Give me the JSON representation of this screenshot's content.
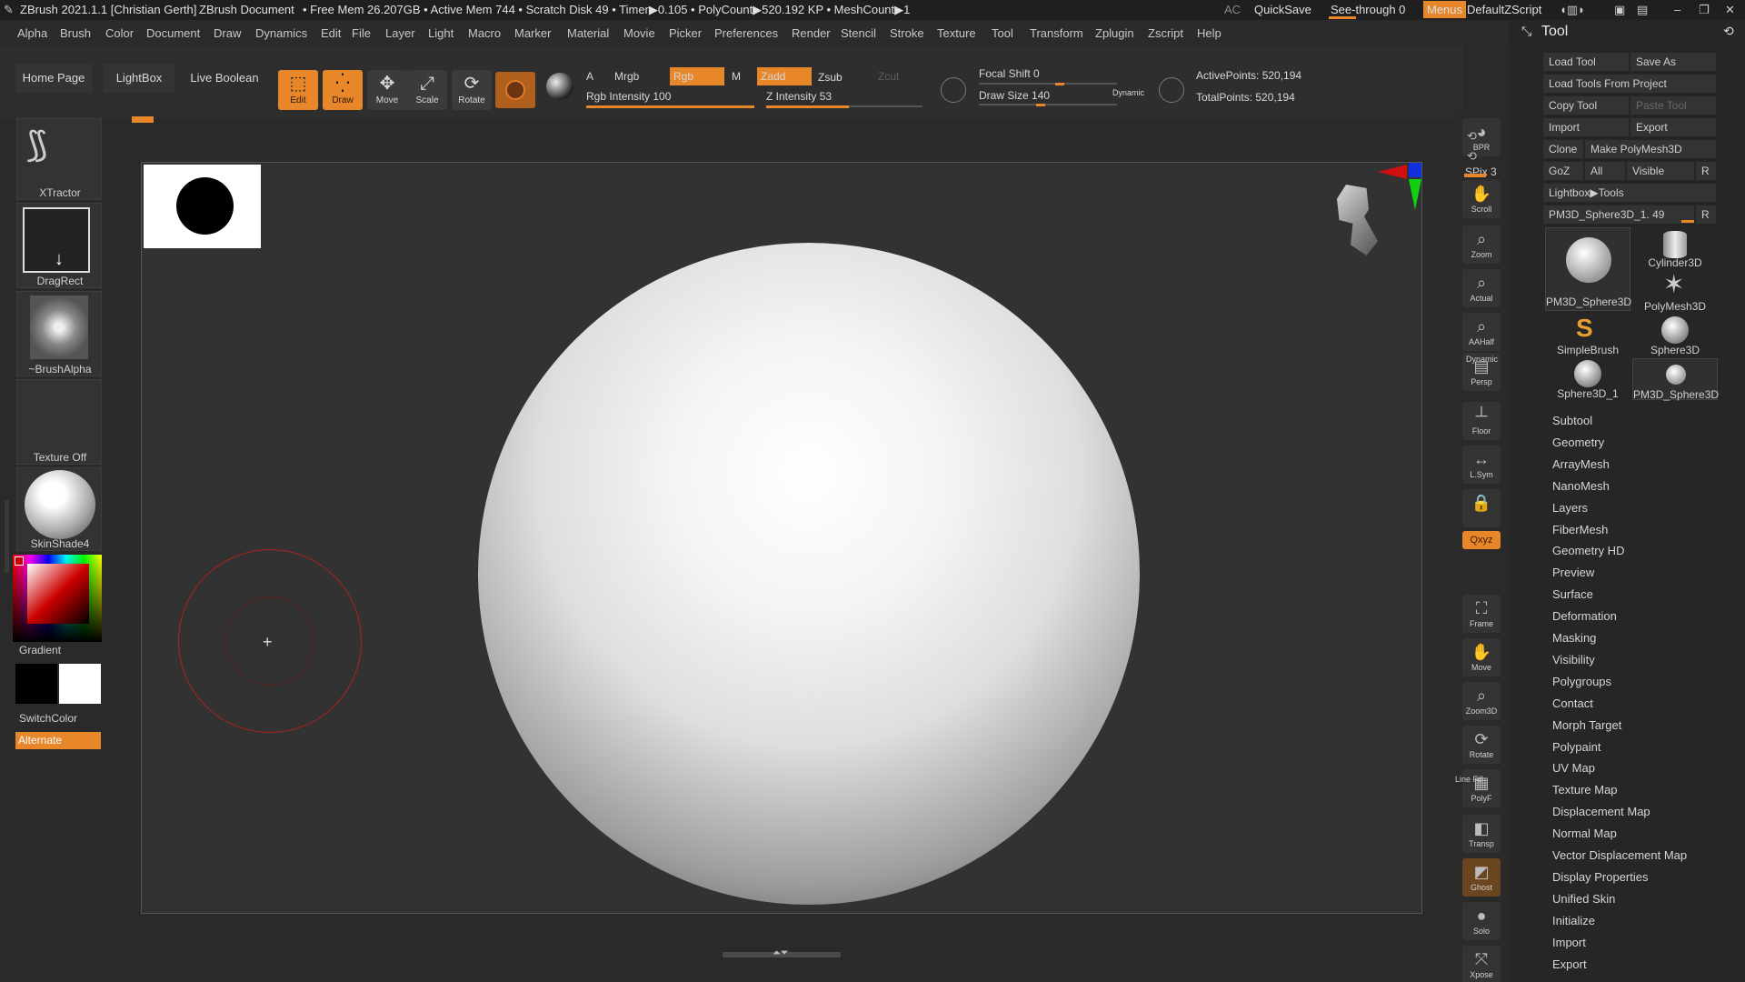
{
  "titlebar": {
    "app": "ZBrush 2021.1.1 [Christian Gerth]",
    "document": "ZBrush Document",
    "stats": "• Free Mem 26.207GB • Active Mem 744 • Scratch Disk 49 • Timer▶0.105 • PolyCount▶520.192 KP • MeshCount▶1",
    "ac": "AC",
    "quicksave": "QuickSave",
    "see_through": "See-through  0",
    "menus": "Menus",
    "script": "DefaultZScript"
  },
  "menubar": [
    "Alpha",
    "Brush",
    "Color",
    "Document",
    "Draw",
    "Dynamics",
    "Edit",
    "File",
    "Layer",
    "Light",
    "Macro",
    "Marker",
    "Material",
    "Movie",
    "Picker",
    "Preferences",
    "Render",
    "Stencil",
    "Stroke",
    "Texture",
    "Tool",
    "Transform",
    "Zplugin",
    "Zscript",
    "Help"
  ],
  "shelf": {
    "home_page": "Home Page",
    "lightbox": "LightBox",
    "live_boolean": "Live Boolean",
    "edit": "Edit",
    "draw": "Draw",
    "move": "Move",
    "scale": "Scale",
    "rotate": "Rotate",
    "a": "A",
    "mrgb": "Mrgb",
    "rgb": "Rgb",
    "m": "M",
    "zadd": "Zadd",
    "zsub": "Zsub",
    "zcut": "Zcut",
    "rgb_intensity": "Rgb Intensity 100",
    "z_intensity": "Z Intensity 53",
    "focal_shift": "Focal Shift 0",
    "draw_size": "Draw Size 140",
    "dynamic": "Dynamic",
    "active_points": "ActivePoints: 520,194",
    "total_points": "TotalPoints: 520,194",
    "rgb_intensity_value": 100,
    "z_intensity_value": 53
  },
  "left_tray": {
    "brush": "XTractor",
    "stroke": "DragRect",
    "alpha": "~BrushAlpha",
    "texture": "Texture Off",
    "material": "SkinShade4",
    "gradient": "Gradient",
    "switch_color": "SwitchColor",
    "alternate": "Alternate"
  },
  "right_shelf": [
    {
      "name": "bpr",
      "label": "BPR",
      "icon": "◕"
    },
    {
      "name": "spix",
      "label": "SPix 3",
      "icon": ""
    },
    {
      "name": "scroll",
      "label": "Scroll",
      "icon": "✋"
    },
    {
      "name": "zoom",
      "label": "Zoom",
      "icon": "⌕"
    },
    {
      "name": "actual",
      "label": "Actual",
      "icon": "⌕"
    },
    {
      "name": "aahalf",
      "label": "AAHalf",
      "icon": "⌕"
    },
    {
      "name": "persp",
      "label": "Persp",
      "icon": "▤"
    },
    {
      "name": "floor",
      "label": "Floor",
      "icon": "┴"
    },
    {
      "name": "lsym",
      "label": "L.Sym",
      "icon": "↔"
    },
    {
      "name": "lock",
      "label": "",
      "icon": "🔒"
    },
    {
      "name": "xyz",
      "label": "Qxyz",
      "icon": ""
    },
    {
      "name": "frame",
      "label": "Frame",
      "icon": "⛶"
    },
    {
      "name": "move",
      "label": "Move",
      "icon": "✋"
    },
    {
      "name": "zoom3d",
      "label": "Zoom3D",
      "icon": "⌕"
    },
    {
      "name": "rotate",
      "label": "Rotate",
      "icon": "⟳"
    },
    {
      "name": "polyf",
      "label": "PolyF",
      "icon": "▦"
    },
    {
      "name": "transp",
      "label": "Transp",
      "icon": "◧"
    },
    {
      "name": "ghost",
      "label": "Ghost",
      "icon": "◩"
    },
    {
      "name": "solo",
      "label": "Solo",
      "icon": "●"
    },
    {
      "name": "xpose",
      "label": "Xpose",
      "icon": "⤧"
    }
  ],
  "right_shelf_extra": {
    "line_fill": "Line Fill",
    "dynamic": "Dynamic"
  },
  "tool_panel": {
    "title": "Tool",
    "load_tool": "Load Tool",
    "save_as": "Save As",
    "load_from_project": "Load Tools From Project",
    "copy_tool": "Copy Tool",
    "paste_tool": "Paste Tool",
    "import": "Import",
    "export": "Export",
    "clone": "Clone",
    "make_polymesh": "Make PolyMesh3D",
    "goz": "GoZ",
    "all": "All",
    "visible": "Visible",
    "r": "R",
    "lightbox_tools": "Lightbox▶Tools",
    "current_tool": "PM3D_Sphere3D_1. 49",
    "thumbs": [
      "PM3D_Sphere3D",
      "Cylinder3D",
      "PolyMesh3D",
      "SimpleBrush",
      "Sphere3D",
      "Sphere3D_1",
      "PM3D_Sphere3D"
    ],
    "sections": [
      "Subtool",
      "Geometry",
      "ArrayMesh",
      "NanoMesh",
      "Layers",
      "FiberMesh",
      "Geometry HD",
      "Preview",
      "Surface",
      "Deformation",
      "Masking",
      "Visibility",
      "Polygroups",
      "Contact",
      "Morph Target",
      "Polypaint",
      "UV Map",
      "Texture Map",
      "Displacement Map",
      "Normal Map",
      "Vector Displacement Map",
      "Display Properties",
      "Unified Skin",
      "Initialize",
      "Import",
      "Export"
    ]
  },
  "colors": {
    "accent": "#e8862a",
    "sphere": "#f2f2f2",
    "brush_circle": "#b02020"
  }
}
